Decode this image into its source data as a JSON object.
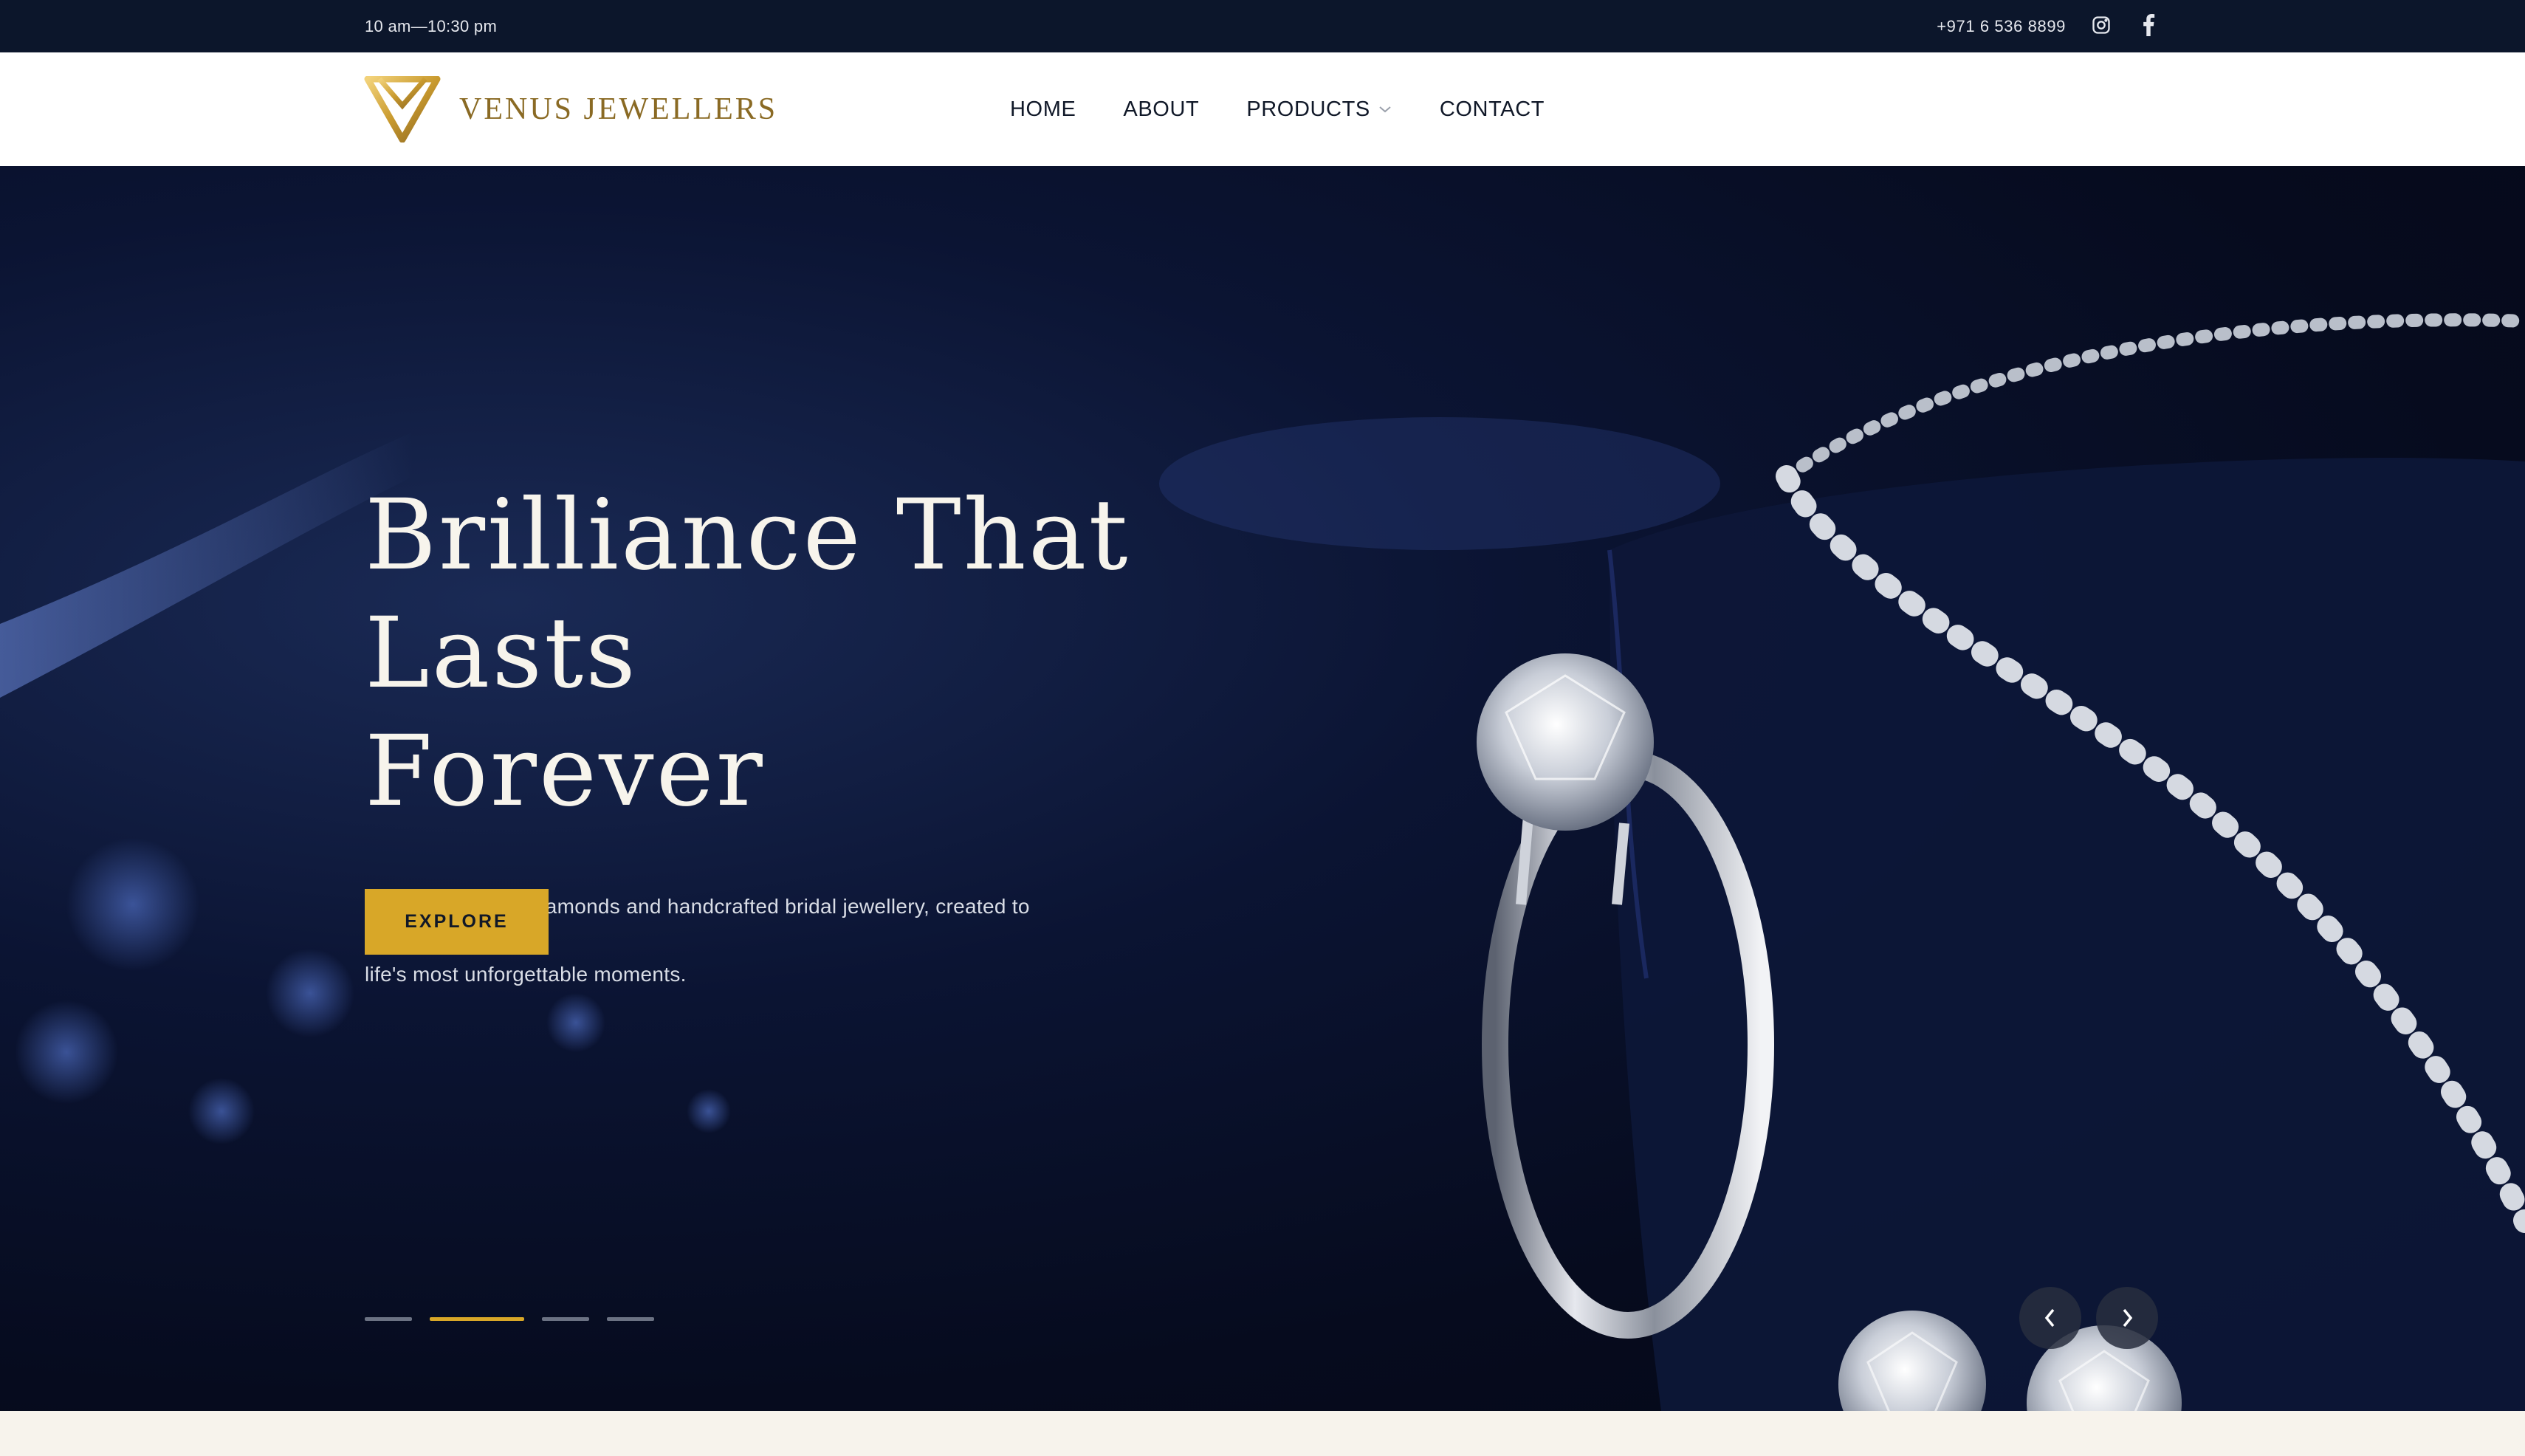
{
  "topbar": {
    "hours": "10 am—10:30 pm",
    "phone": "+971 6 536 8899",
    "social": [
      {
        "icon": "instagram-icon"
      },
      {
        "icon": "facebook-icon"
      }
    ]
  },
  "header": {
    "logo_text": "VENUS JEWELLERS",
    "nav": [
      {
        "label": "HOME"
      },
      {
        "label": "ABOUT"
      },
      {
        "label": "PRODUCTS",
        "icon": "chevron-down-icon"
      },
      {
        "label": "CONTACT"
      }
    ]
  },
  "hero": {
    "title_line1": "Brilliance That Lasts",
    "title_line2": "Forever",
    "subtitle_line1": "Certified solitaire diamonds and handcrafted bridal jewellery, created to celebrate",
    "subtitle_line2": "life's most unforgettable moments.",
    "button_label": "EXPLORE",
    "slides_total": 4,
    "active_slide": 2
  },
  "colors": {
    "topbar_bg": "#0c162b",
    "header_bg": "#ffffff",
    "accent_gold": "#d8a728",
    "logo_gold": "#8a6a24",
    "hero_bg": "#0b1433",
    "page_bg": "#f7f3ec"
  }
}
